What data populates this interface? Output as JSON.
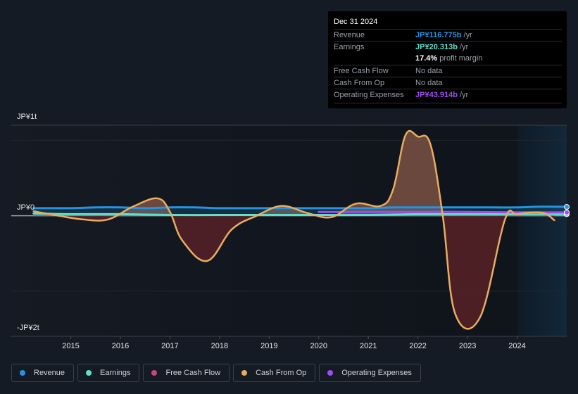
{
  "tooltip": {
    "date": "Dec 31 2024",
    "rows": [
      {
        "label": "Revenue",
        "value": "JP¥116.775b",
        "suffix": " /yr",
        "color": "#2394df"
      },
      {
        "label": "Earnings",
        "value": "JP¥20.313b",
        "suffix": " /yr",
        "color": "#5fe0c9"
      },
      {
        "label": "",
        "value": "17.4%",
        "suffix": " profit margin",
        "color": "#ffffff"
      },
      {
        "label": "Free Cash Flow",
        "value": "",
        "suffix": "No data",
        "color": "#9aa0a8"
      },
      {
        "label": "Cash From Op",
        "value": "",
        "suffix": "No data",
        "color": "#9aa0a8"
      },
      {
        "label": "Operating Expenses",
        "value": "JP¥43.914b",
        "suffix": " /yr",
        "color": "#a04cf0"
      }
    ]
  },
  "legend": [
    {
      "label": "Revenue",
      "color": "#2394df"
    },
    {
      "label": "Earnings",
      "color": "#5fe0c9"
    },
    {
      "label": "Free Cash Flow",
      "color": "#c8457e"
    },
    {
      "label": "Cash From Op",
      "color": "#e8ad5e"
    },
    {
      "label": "Operating Expenses",
      "color": "#a04cf0"
    }
  ],
  "chart_data": {
    "type": "line",
    "title": "",
    "xlabel": "",
    "ylabel": "",
    "unit": "JP¥ trillions",
    "y_tick_labels": [
      "JP¥1t",
      "JP¥0",
      "-JP¥2t"
    ],
    "x_tick_labels": [
      "2015",
      "2016",
      "2017",
      "2018",
      "2019",
      "2020",
      "2021",
      "2022",
      "2023",
      "2024"
    ],
    "xlim": [
      2013.8,
      2025.0
    ],
    "ylim": [
      -1.6,
      1.2
    ],
    "gridlines": [
      1,
      0,
      -1
    ],
    "highlight_from": 2024.0,
    "legend_position": "bottom",
    "series": [
      {
        "name": "Revenue",
        "color": "#2394df",
        "x": [
          2014.25,
          2015.0,
          2015.5,
          2016.0,
          2016.5,
          2017.0,
          2017.5,
          2018.0,
          2018.5,
          2019.0,
          2019.5,
          2020.0,
          2020.5,
          2021.0,
          2021.5,
          2022.0,
          2022.5,
          2023.0,
          2023.5,
          2024.0,
          2024.5,
          2025.0
        ],
        "values": [
          0.1,
          0.1,
          0.11,
          0.11,
          0.1,
          0.11,
          0.11,
          0.1,
          0.1,
          0.1,
          0.1,
          0.1,
          0.1,
          0.1,
          0.11,
          0.11,
          0.11,
          0.11,
          0.11,
          0.11,
          0.12,
          0.117
        ]
      },
      {
        "name": "Earnings",
        "color": "#5fe0c9",
        "x": [
          2014.25,
          2015.0,
          2016.0,
          2017.0,
          2018.0,
          2019.0,
          2020.0,
          2021.0,
          2022.0,
          2023.0,
          2024.0,
          2025.0
        ],
        "values": [
          0.03,
          0.02,
          0.02,
          0.01,
          0.01,
          0.01,
          0.01,
          0.01,
          0.02,
          0.02,
          0.02,
          0.02
        ]
      },
      {
        "name": "Operating Expenses",
        "color": "#a04cf0",
        "x": [
          2020.0,
          2021.0,
          2022.0,
          2023.0,
          2024.0,
          2025.0
        ],
        "values": [
          0.05,
          0.05,
          0.05,
          0.05,
          0.045,
          0.044
        ]
      },
      {
        "name": "Cash From Op",
        "color": "#e8ad5e",
        "x": [
          2014.25,
          2014.75,
          2015.25,
          2015.75,
          2016.25,
          2016.75,
          2017.0,
          2017.25,
          2017.75,
          2018.25,
          2018.75,
          2019.25,
          2019.75,
          2020.25,
          2020.75,
          2021.25,
          2021.5,
          2021.75,
          2022.0,
          2022.25,
          2022.5,
          2022.75,
          2023.25,
          2023.75,
          2024.0,
          2024.5,
          2024.75
        ],
        "values": [
          0.06,
          0.0,
          -0.05,
          -0.05,
          0.12,
          0.23,
          0.05,
          -0.33,
          -0.6,
          -0.18,
          0.0,
          0.13,
          0.04,
          -0.02,
          0.16,
          0.13,
          0.35,
          1.07,
          1.05,
          0.95,
          0.0,
          -1.3,
          -1.35,
          -0.06,
          0.02,
          0.04,
          -0.06
        ]
      },
      {
        "name": "Free Cash Flow",
        "color": "#c8457e",
        "x": [],
        "values": []
      }
    ]
  }
}
